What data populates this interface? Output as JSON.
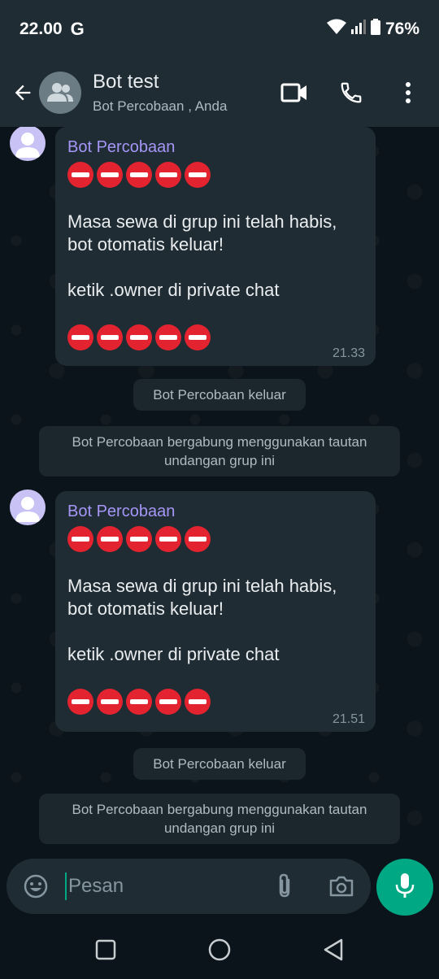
{
  "status_bar": {
    "time": "22.00",
    "google_glyph": "G",
    "battery": "76%",
    "icons": [
      "wifi-icon",
      "signal-icon",
      "battery-icon"
    ]
  },
  "header": {
    "title": "Bot test",
    "subtitle": "Bot Percobaan , Anda",
    "icons": [
      "back-arrow-icon",
      "group-avatar-icon",
      "video-call-icon",
      "phone-icon",
      "more-vert-icon"
    ]
  },
  "messages": [
    {
      "sender": "Bot Percobaan",
      "emoji_count": 5,
      "lines": [
        "Masa sewa di grup ini telah habis,",
        "bot otomatis keluar!",
        "",
        "ketik .owner di private chat"
      ],
      "time": "21.33"
    },
    {
      "sender": "Bot Percobaan",
      "emoji_count": 5,
      "lines": [
        "Masa sewa di grup ini telah habis,",
        "bot otomatis keluar!",
        "",
        "ketik .owner di private chat"
      ],
      "time": "21.51"
    }
  ],
  "system": {
    "left": "Bot Percobaan keluar",
    "joined_line1": "Bot Percobaan bergabung menggunakan tautan",
    "joined_line2": "undangan grup ini"
  },
  "input": {
    "placeholder": "Pesan",
    "icons": [
      "emoji-icon",
      "attach-icon",
      "camera-icon",
      "mic-icon"
    ]
  },
  "colors": {
    "accent": "#00a884",
    "sender_name": "#a596f7",
    "bubble": "#202c33",
    "background": "#0b141a",
    "no_entry": "#e3232f"
  }
}
